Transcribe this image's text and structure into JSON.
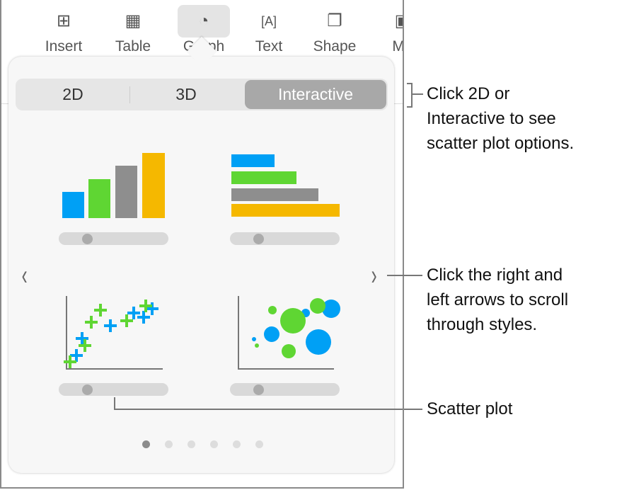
{
  "toolbar": {
    "items": [
      {
        "label": "Insert",
        "icon": "insert-icon"
      },
      {
        "label": "Table",
        "icon": "table-icon"
      },
      {
        "label": "Graph",
        "icon": "chart-icon",
        "selected": true
      },
      {
        "label": "Text",
        "icon": "text-box-icon"
      },
      {
        "label": "Shape",
        "icon": "shape-icon"
      },
      {
        "label": "Me",
        "icon": "media-icon"
      }
    ]
  },
  "segmented": {
    "options": [
      "2D",
      "3D",
      "Interactive"
    ],
    "selected": "Interactive"
  },
  "pager": {
    "pages": 6,
    "current": 1
  },
  "colors": {
    "blue": "#00a0f5",
    "green": "#5fd633",
    "gray": "#8e8e8e",
    "orange": "#f5b800"
  },
  "callouts": {
    "segment": [
      "Click 2D or",
      "Interactive to see",
      "scatter plot options."
    ],
    "arrows": [
      "Click the right and",
      "left arrows to scroll",
      "through styles."
    ],
    "scatter": [
      "Scatter plot"
    ]
  }
}
